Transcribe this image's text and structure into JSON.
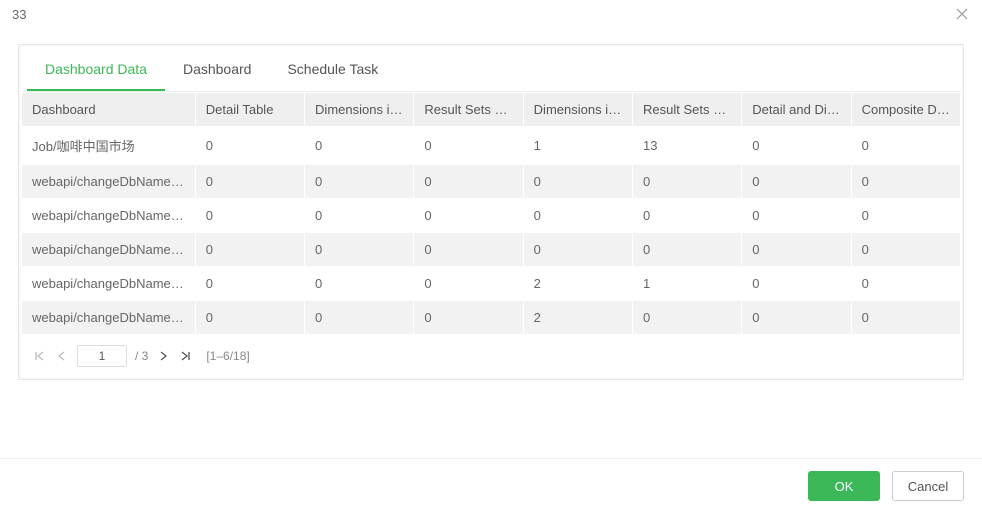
{
  "title": "33",
  "tabs": [
    {
      "label": "Dashboard Data",
      "active": true
    },
    {
      "label": "Dashboard",
      "active": false
    },
    {
      "label": "Schedule Task",
      "active": false
    }
  ],
  "columns": [
    "Dashboard",
    "Detail Table",
    "Dimensions in Deta",
    "Result Sets of De",
    "Dimensions in Aggr",
    "Result Sets of Aggr",
    "Detail and Dimensi",
    "Composite Data Set"
  ],
  "rows": [
    {
      "cells": [
        "Job/咖啡中国市场",
        "0",
        "0",
        "0",
        "1",
        "13",
        "0",
        "0"
      ]
    },
    {
      "cells": [
        "webapi/changeDbName/ch",
        "0",
        "0",
        "0",
        "0",
        "0",
        "0",
        "0"
      ]
    },
    {
      "cells": [
        "webapi/changeDbName/ch",
        "0",
        "0",
        "0",
        "0",
        "0",
        "0",
        "0"
      ]
    },
    {
      "cells": [
        "webapi/changeDbName/ch",
        "0",
        "0",
        "0",
        "0",
        "0",
        "0",
        "0"
      ]
    },
    {
      "cells": [
        "webapi/changeDbName/ch",
        "0",
        "0",
        "0",
        "2",
        "1",
        "0",
        "0"
      ]
    },
    {
      "cells": [
        "webapi/changeDbName/ch",
        "0",
        "0",
        "0",
        "2",
        "0",
        "0",
        "0"
      ]
    }
  ],
  "pager": {
    "current_page": "1",
    "total_pages_label": "/ 3",
    "range_label": "[1–6/18]"
  },
  "buttons": {
    "ok": "OK",
    "cancel": "Cancel"
  }
}
